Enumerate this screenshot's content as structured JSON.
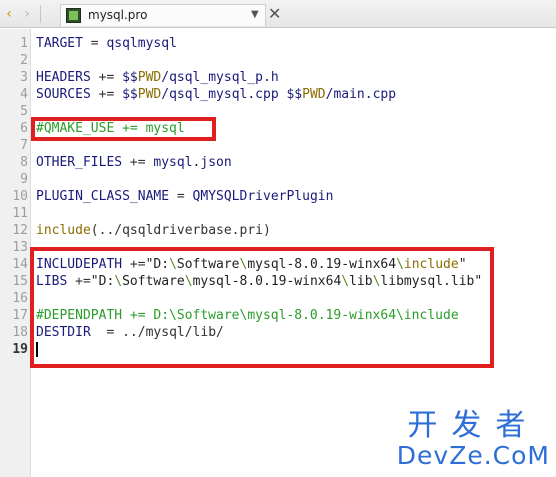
{
  "tabbar": {
    "back_glyph": "‹",
    "forward_glyph": "›",
    "file_tab": "mysql.pro",
    "dropdown_glyph": "▼",
    "close_glyph": "✕"
  },
  "editor": {
    "current_line": 19,
    "lines": [
      {
        "n": "1",
        "segments": [
          {
            "c": "kw",
            "t": "TARGET "
          },
          {
            "c": "op",
            "t": "= "
          },
          {
            "c": "kw",
            "t": "qsqlmysql"
          }
        ]
      },
      {
        "n": "2",
        "segments": []
      },
      {
        "n": "3",
        "segments": [
          {
            "c": "kw",
            "t": "HEADERS "
          },
          {
            "c": "op",
            "t": "+= "
          },
          {
            "c": "kw",
            "t": "$$"
          },
          {
            "c": "var",
            "t": "PWD"
          },
          {
            "c": "kw",
            "t": "/qsql_mysql_p.h"
          }
        ]
      },
      {
        "n": "4",
        "segments": [
          {
            "c": "kw",
            "t": "SOURCES "
          },
          {
            "c": "op",
            "t": "+= "
          },
          {
            "c": "kw",
            "t": "$$"
          },
          {
            "c": "var",
            "t": "PWD"
          },
          {
            "c": "kw",
            "t": "/qsql_mysql.cpp "
          },
          {
            "c": "kw",
            "t": "$$"
          },
          {
            "c": "var",
            "t": "PWD"
          },
          {
            "c": "kw",
            "t": "/main.cpp"
          }
        ]
      },
      {
        "n": "5",
        "segments": []
      },
      {
        "n": "6",
        "segments": [
          {
            "c": "cm",
            "t": "#QMAKE_USE += mysql"
          }
        ]
      },
      {
        "n": "7",
        "segments": []
      },
      {
        "n": "8",
        "segments": [
          {
            "c": "kw",
            "t": "OTHER_FILES "
          },
          {
            "c": "op",
            "t": "+= "
          },
          {
            "c": "kw",
            "t": "mysql.json"
          }
        ]
      },
      {
        "n": "9",
        "segments": []
      },
      {
        "n": "10",
        "segments": [
          {
            "c": "kw",
            "t": "PLUGIN_CLASS_NAME "
          },
          {
            "c": "op",
            "t": "= "
          },
          {
            "c": "kw",
            "t": "QMYSQLDriverPlugin"
          }
        ]
      },
      {
        "n": "11",
        "segments": []
      },
      {
        "n": "12",
        "segments": [
          {
            "c": "fn",
            "t": "include"
          },
          {
            "c": "pl",
            "t": "(../qsqldriverbase.pri)"
          }
        ]
      },
      {
        "n": "13",
        "segments": []
      },
      {
        "n": "14",
        "segments": [
          {
            "c": "kw",
            "t": "INCLUDEPATH "
          },
          {
            "c": "op",
            "t": "+="
          },
          {
            "c": "st",
            "t": "\"D:"
          },
          {
            "c": "bs",
            "t": "\\"
          },
          {
            "c": "st",
            "t": "Software"
          },
          {
            "c": "bs",
            "t": "\\"
          },
          {
            "c": "st",
            "t": "mysql-8.0.19-winx64"
          },
          {
            "c": "bs",
            "t": "\\"
          },
          {
            "c": "fn",
            "t": "include"
          },
          {
            "c": "st",
            "t": "\""
          }
        ]
      },
      {
        "n": "15",
        "segments": [
          {
            "c": "kw",
            "t": "LIBS "
          },
          {
            "c": "op",
            "t": "+="
          },
          {
            "c": "st",
            "t": "\"D:"
          },
          {
            "c": "bs",
            "t": "\\"
          },
          {
            "c": "st",
            "t": "Software"
          },
          {
            "c": "bs",
            "t": "\\"
          },
          {
            "c": "st",
            "t": "mysql-8.0.19-winx64"
          },
          {
            "c": "bs",
            "t": "\\"
          },
          {
            "c": "st",
            "t": "lib"
          },
          {
            "c": "bs",
            "t": "\\"
          },
          {
            "c": "st",
            "t": "libmysql.lib\""
          }
        ]
      },
      {
        "n": "16",
        "segments": []
      },
      {
        "n": "17",
        "segments": [
          {
            "c": "cm",
            "t": "#DEPENDPATH += D:\\Software\\mysql-8.0.19-winx64\\include"
          }
        ]
      },
      {
        "n": "18",
        "segments": [
          {
            "c": "kw",
            "t": "DESTDIR  "
          },
          {
            "c": "op",
            "t": "= "
          },
          {
            "c": "pl",
            "t": "../mysql/lib/"
          }
        ]
      },
      {
        "n": "19",
        "segments": []
      }
    ]
  },
  "watermark": {
    "cn": "开发者",
    "en": "DevZe.CoM"
  },
  "colors": {
    "highlight_box": "#e02020",
    "watermark": "#2d6fd6",
    "comment": "#2a9d2a",
    "keyword": "#1a1a7a",
    "variable": "#8a6d00"
  }
}
